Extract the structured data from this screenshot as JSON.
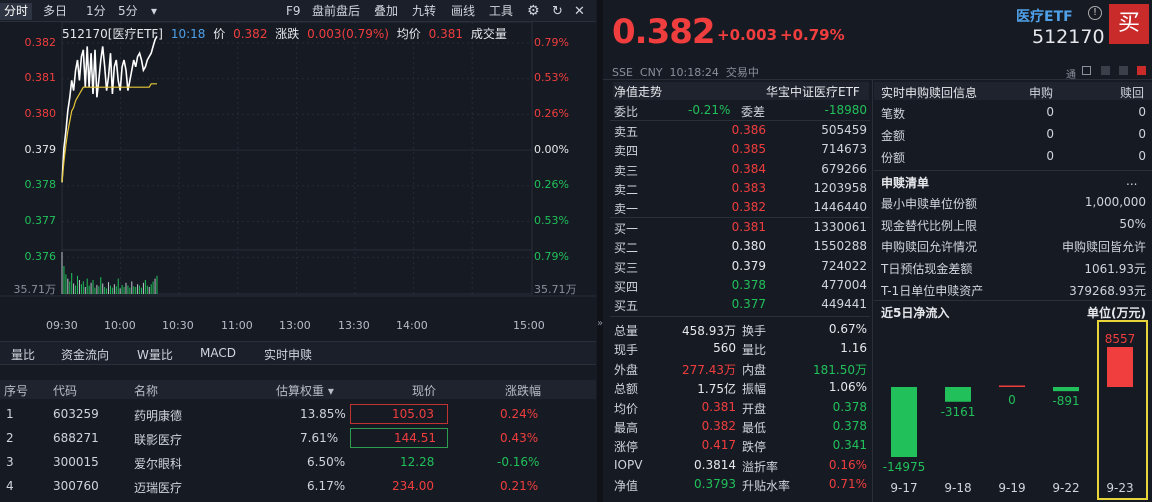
{
  "toolbar": {
    "tabs": [
      "分时",
      "多日",
      "1分",
      "5分",
      "▾"
    ],
    "right": [
      "F9",
      "盘前盘后",
      "叠加",
      "九转",
      "画线",
      "工具"
    ]
  },
  "chart": {
    "info": {
      "code": "512170[医疗ETF]",
      "time": "10:18",
      "price_label": "价",
      "price": "0.382",
      "chg_label": "涨跌",
      "chg": "0.003(0.79%)",
      "avg_label": "均价",
      "avg": "0.381",
      "vol_label": "成交量"
    },
    "y_left": [
      "0.382",
      "0.381",
      "0.380",
      "0.379",
      "0.378",
      "0.377",
      "0.376"
    ],
    "y_right": [
      "0.79%",
      "0.53%",
      "0.26%",
      "0.00%",
      "0.26%",
      "0.53%",
      "0.79%"
    ],
    "vol_label": "35.71万",
    "vol_label_r": "35.71万",
    "x_labels": [
      "09:30",
      "10:30",
      "11:00",
      "13:00",
      "13:30",
      "14:00",
      "15:00",
      "10:00"
    ],
    "price_series": [
      0.3782,
      0.3792,
      0.3797,
      0.3803,
      0.3807,
      0.3812,
      0.3809,
      0.3815,
      0.3818,
      0.3812,
      0.3819,
      0.3821,
      0.381,
      0.3822,
      0.381,
      0.382,
      0.3808,
      0.3821,
      0.3807,
      0.3812,
      0.3818,
      0.3822,
      0.3816,
      0.3809,
      0.3813,
      0.382,
      0.3808,
      0.3816,
      0.3818,
      0.3812,
      0.3809,
      0.3816,
      0.3818,
      0.3815,
      0.3809,
      0.3812,
      0.3815,
      0.3818,
      0.3816,
      0.3819,
      0.382,
      0.3818,
      0.3815,
      0.3816,
      0.3818,
      0.3819,
      0.382,
      0.3822,
      0.3824,
      0.3825
    ],
    "avg_series": [
      0.3782,
      0.3788,
      0.3793,
      0.3797,
      0.38,
      0.3803,
      0.3804,
      0.3806,
      0.3807,
      0.3808,
      0.3809,
      0.381,
      0.381,
      0.381,
      0.381,
      0.381,
      0.381,
      0.381,
      0.381,
      0.381,
      0.381,
      0.381,
      0.381,
      0.381,
      0.381,
      0.381,
      0.381,
      0.381,
      0.381,
      0.381,
      0.381,
      0.381,
      0.381,
      0.381,
      0.381,
      0.381,
      0.381,
      0.381,
      0.381,
      0.381,
      0.381,
      0.381,
      0.381,
      0.381,
      0.381,
      0.381,
      0.3811,
      0.3811,
      0.3811,
      0.3811
    ]
  },
  "tabs": [
    "量比",
    "资金流向",
    "W量比",
    "MACD",
    "实时申赎"
  ],
  "holdings": {
    "headers": [
      "序号",
      "代码",
      "名称",
      "估算权重 ▾",
      "现价",
      "涨跌幅"
    ],
    "rows": [
      [
        "1",
        "603259",
        "药明康德",
        "13.85%",
        "105.03",
        "0.24%"
      ],
      [
        "2",
        "688271",
        "联影医疗",
        "7.61%",
        "144.51",
        "0.43%"
      ],
      [
        "3",
        "300015",
        "爱尔眼科",
        "6.50%",
        "12.28",
        "-0.16%"
      ],
      [
        "4",
        "300760",
        "迈瑞医疗",
        "6.17%",
        "234.00",
        "0.21%"
      ]
    ]
  },
  "quote": {
    "name": "医疗ETF",
    "code": "512170",
    "price": "0.382",
    "chg": "+0.003",
    "pct": "+0.79%",
    "meta": "SSE  CNY  10:18:24  交易中",
    "buy": "买",
    "toolicons": "通"
  },
  "book": {
    "title": "净值走势",
    "subtitle": "华宝中证医疗ETF",
    "weibi_label": "委比",
    "weibi": "-0.21%",
    "weicha_label": "委差",
    "weicha": "-18980",
    "sells": [
      [
        "卖五",
        "0.386",
        "505459"
      ],
      [
        "卖四",
        "0.385",
        "714673"
      ],
      [
        "卖三",
        "0.384",
        "679266"
      ],
      [
        "卖二",
        "0.383",
        "1203958"
      ],
      [
        "卖一",
        "0.382",
        "1446440"
      ]
    ],
    "buys": [
      [
        "买一",
        "0.381",
        "1330061"
      ],
      [
        "买二",
        "0.380",
        "1550288"
      ],
      [
        "买三",
        "0.379",
        "724022"
      ],
      [
        "买四",
        "0.378",
        "477004"
      ],
      [
        "买五",
        "0.377",
        "449441"
      ]
    ],
    "stats": [
      [
        "总量",
        "458.93万",
        "换手",
        "0.67%"
      ],
      [
        "现手",
        "560",
        "量比",
        "1.16"
      ],
      [
        "外盘",
        "277.43万",
        "内盘",
        "181.50万"
      ],
      [
        "总额",
        "1.75亿",
        "振幅",
        "1.06%"
      ],
      [
        "均价",
        "0.381",
        "开盘",
        "0.378"
      ],
      [
        "最高",
        "0.382",
        "最低",
        "0.378"
      ],
      [
        "涨停",
        "0.417",
        "跌停",
        "0.341"
      ],
      [
        "IOPV",
        "0.3814",
        "溢折率",
        "0.16%"
      ],
      [
        "净值",
        "0.3793",
        "升贴水率",
        "0.71%"
      ]
    ]
  },
  "realtime": {
    "title": "实时申购赎回信息",
    "col1": "申购",
    "col2": "赎回",
    "rows": [
      [
        "笔数",
        "0",
        "0"
      ],
      [
        "金额",
        "0",
        "0"
      ],
      [
        "份额",
        "0",
        "0"
      ]
    ]
  },
  "subscribe": {
    "title": "申赎清单",
    "more": "...",
    "rows": [
      [
        "最小申赎单位份额",
        "1,000,000"
      ],
      [
        "现金替代比例上限",
        "50%"
      ],
      [
        "申购赎回允许情况",
        "申购赎回皆允许"
      ],
      [
        "T日预估现金差额",
        "1061.93元"
      ],
      [
        "T-1日单位申赎资产",
        "379268.93元"
      ]
    ]
  },
  "flow": {
    "title": "近5日净流入",
    "unit": "单位(万元)",
    "dates": [
      "9-17",
      "9-18",
      "9-19",
      "9-22",
      "9-23"
    ],
    "values": [
      -14975,
      -3161,
      0,
      -891,
      8557
    ]
  }
}
